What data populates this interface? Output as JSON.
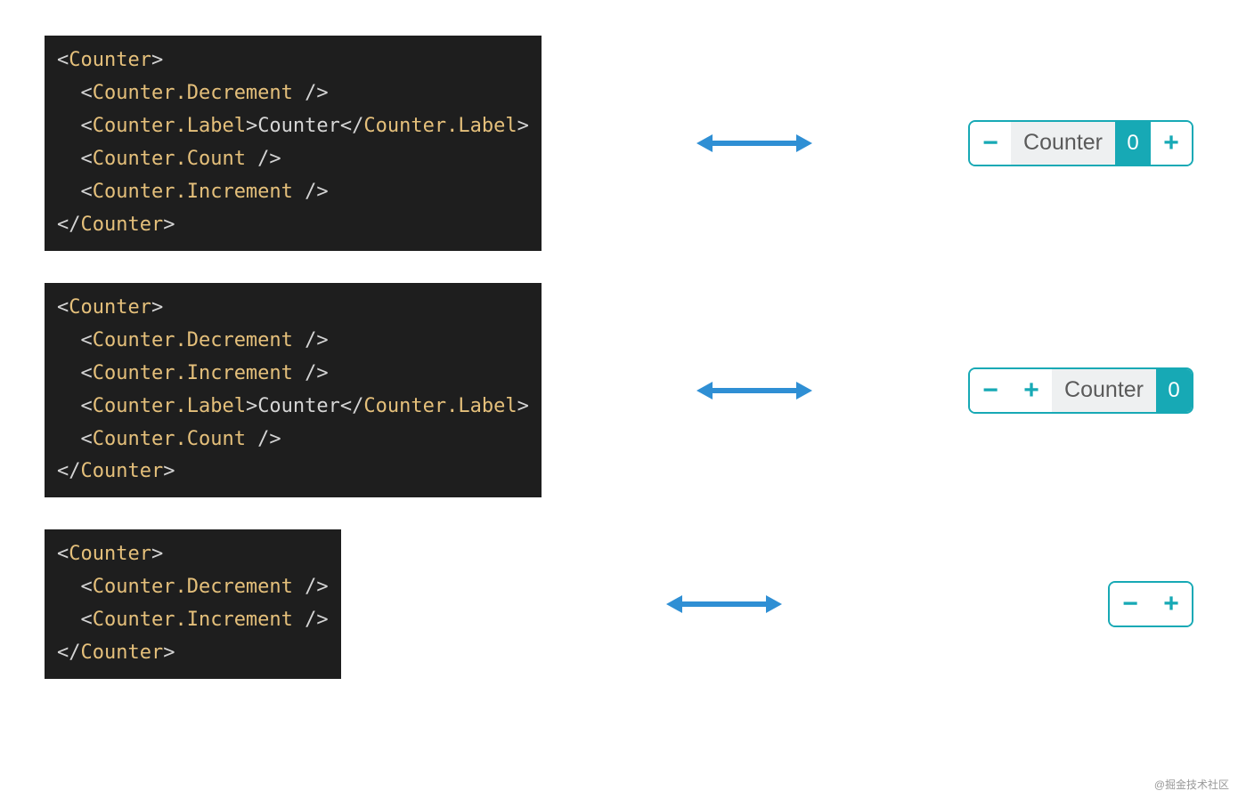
{
  "examples": [
    {
      "code_lines": [
        [
          {
            "t": "angle",
            "v": "<"
          },
          {
            "t": "tag",
            "v": "Counter"
          },
          {
            "t": "angle",
            "v": ">"
          }
        ],
        [
          {
            "t": "txt",
            "v": "  "
          },
          {
            "t": "angle",
            "v": "<"
          },
          {
            "t": "tag",
            "v": "Counter.Decrement"
          },
          {
            "t": "angle",
            "v": " />"
          }
        ],
        [
          {
            "t": "txt",
            "v": "  "
          },
          {
            "t": "angle",
            "v": "<"
          },
          {
            "t": "tag",
            "v": "Counter.Label"
          },
          {
            "t": "angle",
            "v": ">"
          },
          {
            "t": "txt",
            "v": "Counter"
          },
          {
            "t": "angle",
            "v": "</"
          },
          {
            "t": "tag",
            "v": "Counter.Label"
          },
          {
            "t": "angle",
            "v": ">"
          }
        ],
        [
          {
            "t": "txt",
            "v": "  "
          },
          {
            "t": "angle",
            "v": "<"
          },
          {
            "t": "tag",
            "v": "Counter.Count"
          },
          {
            "t": "angle",
            "v": " />"
          }
        ],
        [
          {
            "t": "txt",
            "v": "  "
          },
          {
            "t": "angle",
            "v": "<"
          },
          {
            "t": "tag",
            "v": "Counter.Increment"
          },
          {
            "t": "angle",
            "v": " />"
          }
        ],
        [
          {
            "t": "angle",
            "v": "</"
          },
          {
            "t": "tag",
            "v": "Counter"
          },
          {
            "t": "angle",
            "v": ">"
          }
        ]
      ],
      "widget": [
        {
          "type": "decrement",
          "glyph": "−"
        },
        {
          "type": "label",
          "text": "Counter"
        },
        {
          "type": "count",
          "text": "0"
        },
        {
          "type": "increment",
          "glyph": "+"
        }
      ]
    },
    {
      "code_lines": [
        [
          {
            "t": "angle",
            "v": "<"
          },
          {
            "t": "tag",
            "v": "Counter"
          },
          {
            "t": "angle",
            "v": ">"
          }
        ],
        [
          {
            "t": "txt",
            "v": "  "
          },
          {
            "t": "angle",
            "v": "<"
          },
          {
            "t": "tag",
            "v": "Counter.Decrement"
          },
          {
            "t": "angle",
            "v": " />"
          }
        ],
        [
          {
            "t": "txt",
            "v": "  "
          },
          {
            "t": "angle",
            "v": "<"
          },
          {
            "t": "tag",
            "v": "Counter.Increment"
          },
          {
            "t": "angle",
            "v": " />"
          }
        ],
        [
          {
            "t": "txt",
            "v": "  "
          },
          {
            "t": "angle",
            "v": "<"
          },
          {
            "t": "tag",
            "v": "Counter.Label"
          },
          {
            "t": "angle",
            "v": ">"
          },
          {
            "t": "txt",
            "v": "Counter"
          },
          {
            "t": "angle",
            "v": "</"
          },
          {
            "t": "tag",
            "v": "Counter.Label"
          },
          {
            "t": "angle",
            "v": ">"
          }
        ],
        [
          {
            "t": "txt",
            "v": "  "
          },
          {
            "t": "angle",
            "v": "<"
          },
          {
            "t": "tag",
            "v": "Counter.Count"
          },
          {
            "t": "angle",
            "v": " />"
          }
        ],
        [
          {
            "t": "angle",
            "v": "</"
          },
          {
            "t": "tag",
            "v": "Counter"
          },
          {
            "t": "angle",
            "v": ">"
          }
        ]
      ],
      "widget": [
        {
          "type": "decrement",
          "glyph": "−"
        },
        {
          "type": "increment",
          "glyph": "+"
        },
        {
          "type": "label",
          "text": "Counter"
        },
        {
          "type": "count",
          "text": "0"
        }
      ]
    },
    {
      "code_lines": [
        [
          {
            "t": "angle",
            "v": "<"
          },
          {
            "t": "tag",
            "v": "Counter"
          },
          {
            "t": "angle",
            "v": ">"
          }
        ],
        [
          {
            "t": "txt",
            "v": "  "
          },
          {
            "t": "angle",
            "v": "<"
          },
          {
            "t": "tag",
            "v": "Counter.Decrement"
          },
          {
            "t": "angle",
            "v": " />"
          }
        ],
        [
          {
            "t": "txt",
            "v": "  "
          },
          {
            "t": "angle",
            "v": "<"
          },
          {
            "t": "tag",
            "v": "Counter.Increment"
          },
          {
            "t": "angle",
            "v": " />"
          }
        ],
        [
          {
            "t": "angle",
            "v": "</"
          },
          {
            "t": "tag",
            "v": "Counter"
          },
          {
            "t": "angle",
            "v": ">"
          }
        ]
      ],
      "widget": [
        {
          "type": "decrement",
          "glyph": "−"
        },
        {
          "type": "increment",
          "glyph": "+"
        }
      ]
    }
  ],
  "watermark": "@掘金技术社区"
}
